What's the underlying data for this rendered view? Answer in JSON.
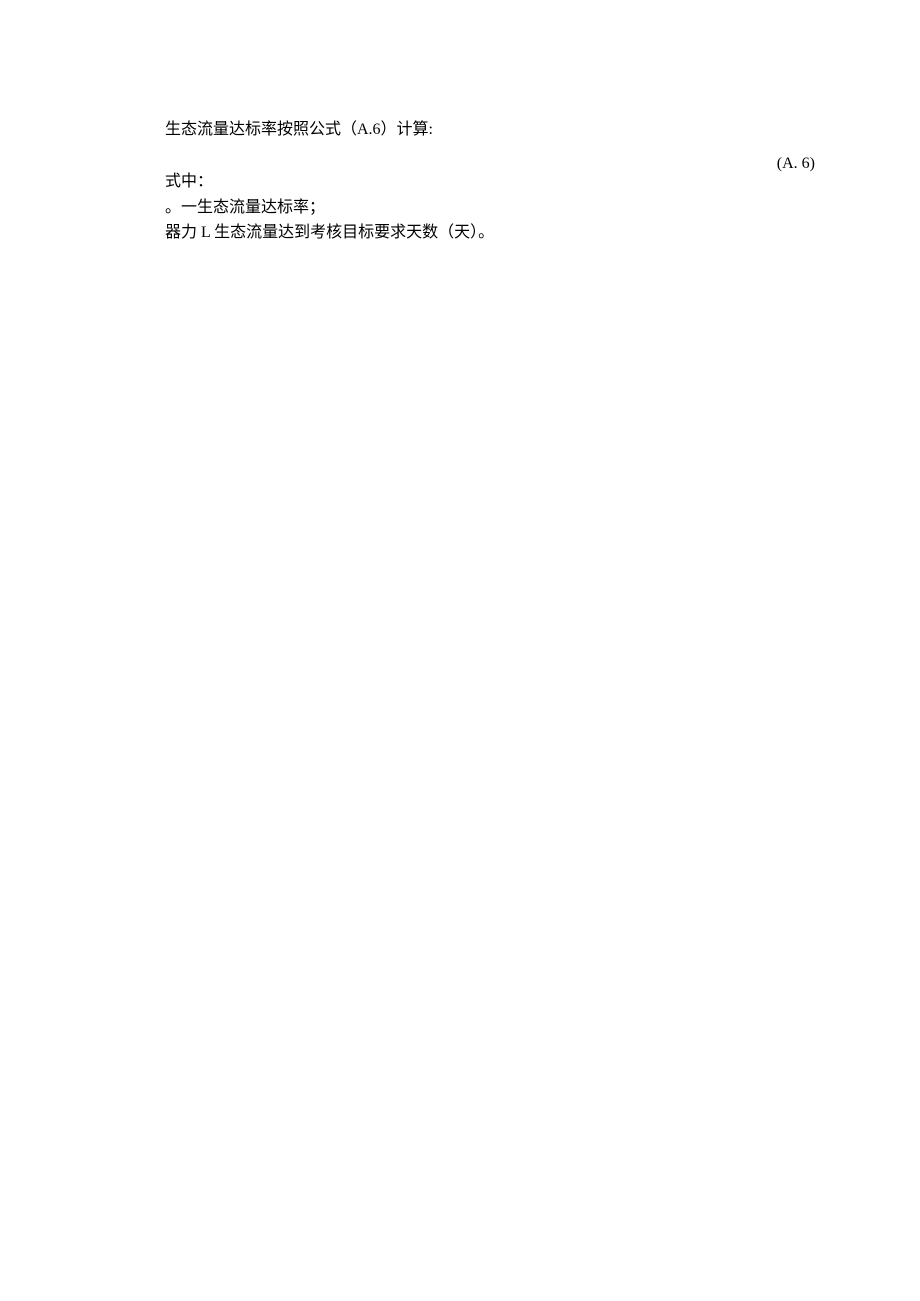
{
  "document": {
    "line1": "生态流量达标率按照公式（A.6）计算:",
    "equation_label": "(A.  6)",
    "line2": "式中：",
    "line3": "。一生态流量达标率；",
    "line4": "器力 L 生态流量达到考核目标要求天数（天）。"
  }
}
